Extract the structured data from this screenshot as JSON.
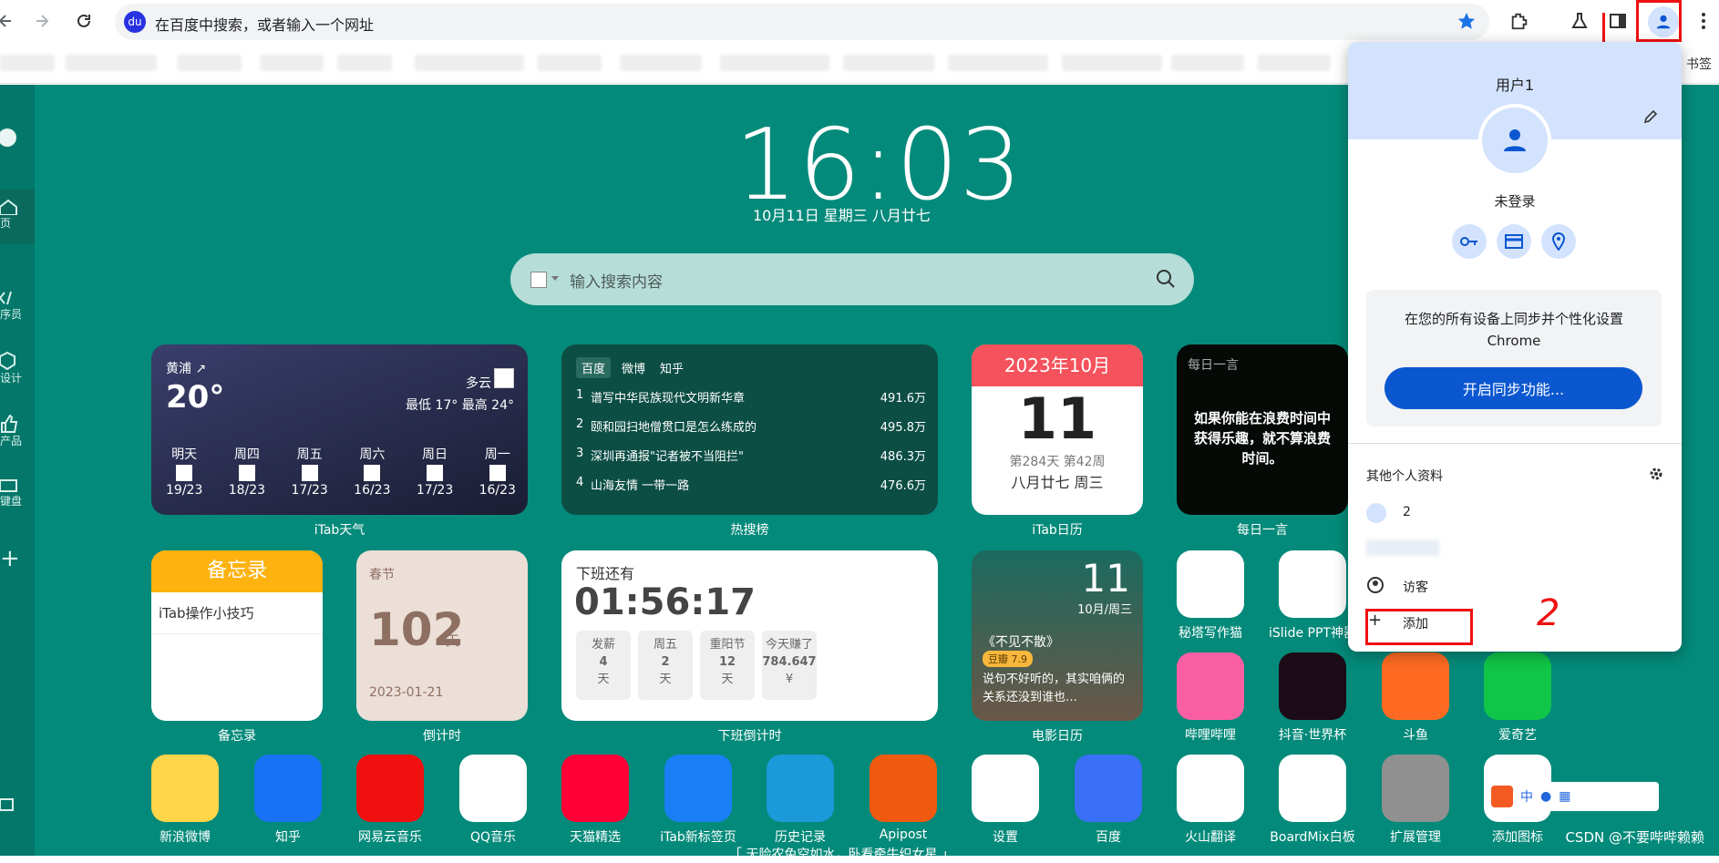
{
  "omnibox": {
    "placeholder_text": "在百度中搜索，或者输入一个网址"
  },
  "bookmarks": {
    "overflow_label": "书签"
  },
  "sidebar": {
    "items": [
      {
        "label": "页"
      },
      {
        "label": "序员"
      },
      {
        "label": "设计"
      },
      {
        "label": "产品"
      },
      {
        "label": "键盘"
      }
    ]
  },
  "clock": {
    "time": "16:03",
    "date": "10月11日  星期三  八月廿七"
  },
  "search": {
    "placeholder": "输入搜索内容"
  },
  "weather": {
    "location": "黄浦 ↗",
    "temp": "20°",
    "condition": "多云",
    "range": "最低 17° 最高 24°",
    "days": [
      {
        "name": "明天",
        "temp": "19/23"
      },
      {
        "name": "周四",
        "temp": "18/23"
      },
      {
        "name": "周五",
        "temp": "17/23"
      },
      {
        "name": "周六",
        "temp": "16/23"
      },
      {
        "name": "周日",
        "temp": "17/23"
      },
      {
        "name": "周一",
        "temp": "16/23"
      }
    ],
    "label": "iTab天气"
  },
  "hot": {
    "tabs": [
      "百度",
      "微博",
      "知乎"
    ],
    "items": [
      {
        "rank": "1",
        "title": "谱写中华民族现代文明新华章",
        "count": "491.6万"
      },
      {
        "rank": "2",
        "title": "颐和园扫地僧贯口是怎么练成的",
        "count": "495.8万"
      },
      {
        "rank": "3",
        "title": "深圳再通报\"记者被不当阻拦\"",
        "count": "486.3万"
      },
      {
        "rank": "4",
        "title": "山海友情 一带一路",
        "count": "476.6万"
      }
    ],
    "label": "热搜榜"
  },
  "calendar": {
    "month": "2023年10月",
    "day": "11",
    "week": "第284天 第42周",
    "lunar": "八月廿七 周三",
    "label": "iTab日历"
  },
  "quote": {
    "title": "每日一言",
    "text": "如果你能在浪费时间中获得乐趣，就不算浪费时间。",
    "label": "每日一言"
  },
  "memo": {
    "title": "备忘录",
    "item": "iTab操作小技巧",
    "label": "备忘录"
  },
  "countdown": {
    "event": "春节",
    "days": "102",
    "unit": "天",
    "date": "2023-01-21",
    "label": "倒计时"
  },
  "offwork": {
    "title": "下班还有",
    "time": "01:56:17",
    "stats": [
      {
        "k": "发薪",
        "v": "4",
        "u": "天"
      },
      {
        "k": "周五",
        "v": "2",
        "u": "天"
      },
      {
        "k": "重阳节",
        "v": "12",
        "u": "天"
      },
      {
        "k": "今天赚了",
        "v": "784.647",
        "u": "¥"
      }
    ],
    "label": "下班倒计时"
  },
  "movie": {
    "day": "11",
    "date": "10月/周三",
    "name": "《不见不散》",
    "score": "豆瓣 7.9",
    "quote": "说句不好听的，其实咱俩的关系还没到谁也…",
    "label": "电影日历"
  },
  "apps_row2": [
    {
      "label": "秘塔写作猫",
      "color": "#ffffff"
    },
    {
      "label": "iSlide PPT神器",
      "color": "#ffffff"
    }
  ],
  "apps_row3": [
    {
      "label": "哔哩哔哩",
      "color": "#fb5fa3"
    },
    {
      "label": "抖音·世界杯",
      "color": "#1c0c18"
    },
    {
      "label": "斗鱼",
      "color": "#ff6a22"
    },
    {
      "label": "爱奇艺",
      "color": "#11c548"
    }
  ],
  "apps_row4": [
    {
      "label": "新浪微博",
      "color": "#ffd54a"
    },
    {
      "label": "知乎",
      "color": "#1772f6"
    },
    {
      "label": "网易云音乐",
      "color": "#f01010"
    },
    {
      "label": "QQ音乐",
      "color": "#ffffff"
    },
    {
      "label": "天猫精选",
      "color": "#ff0036"
    },
    {
      "label": "iTab新标签页",
      "color": "#1a7ff4"
    },
    {
      "label": "历史记录",
      "color": "#1a9ad8"
    },
    {
      "label": "Apipost",
      "color": "#f05a10"
    },
    {
      "label": "设置",
      "color": "#ffffff"
    },
    {
      "label": "百度",
      "color": "#3a6ff7"
    },
    {
      "label": "火山翻译",
      "color": "#ffffff"
    },
    {
      "label": "BoardMix白板",
      "color": "#ffffff"
    },
    {
      "label": "扩展管理",
      "color": "#909090"
    },
    {
      "label": "添加图标",
      "color": "#ffffff"
    }
  ],
  "bottom_text": "「 天险农兔空如水，卧看牵牛织女星 」",
  "profile": {
    "name": "用户1",
    "status": "未登录",
    "sync_text": "在您的所有设备上同步并个性化设置 Chrome",
    "sync_button": "开启同步功能...",
    "others_title": "其他个人资料",
    "others": [
      {
        "label": "2"
      },
      {
        "label": "访客"
      },
      {
        "label": "添加"
      }
    ]
  },
  "annotation": {
    "mark": "2"
  },
  "watermark": "CSDN @不要哔哔赖赖",
  "ime": {
    "label": "中"
  }
}
